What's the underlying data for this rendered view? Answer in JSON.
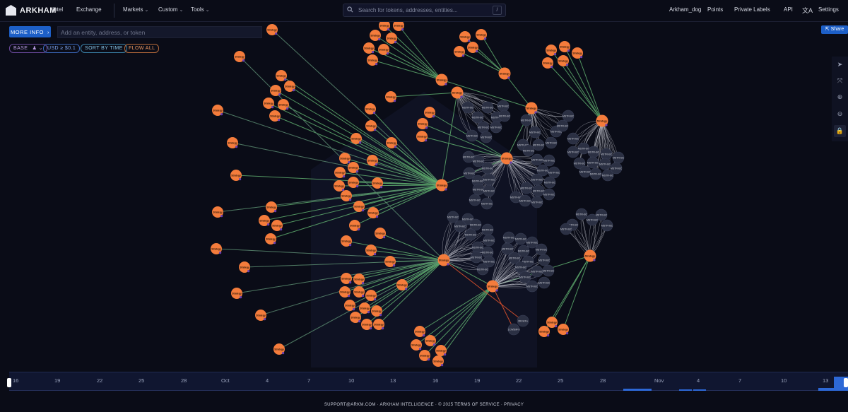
{
  "header": {
    "logo_text": "ARKHAM",
    "nav": [
      {
        "label": "Intel",
        "chevron": false
      },
      {
        "label": "Exchange",
        "chevron": false
      },
      {
        "label": "Markets",
        "chevron": true
      },
      {
        "label": "Custom",
        "chevron": true
      },
      {
        "label": "Tools",
        "chevron": true
      }
    ],
    "search": {
      "placeholder": "Search for tokens, addresses, entities...",
      "shortcut": "/"
    },
    "right_nav": [
      "Arkham_dog",
      "Points",
      "Private Labels",
      "API",
      "Settings"
    ],
    "translate_icon": "translate-icon"
  },
  "toolbar": {
    "more_info_label": "MORE INFO",
    "entity_input_placeholder": "Add an entity, address, or token",
    "filters": {
      "base": "BASE",
      "usd": "USD ≥ $0.1",
      "sort": "SORT BY TIME",
      "flow": "FLOW ALL"
    },
    "share_label": "Share"
  },
  "graph": {
    "entity_node_label": "Strategy",
    "address_node_label": "MSTR-BC",
    "colors": {
      "background": "#0a0c17",
      "entity_node": "#f47c3c",
      "address_node": "#2b3043",
      "inflow_edge": "#5fae6e",
      "outflow_edge": "#c94b2b",
      "internal_edge": "#c9cbd4"
    },
    "special_nodes": [
      "3RmKFu",
      "1CW5MFb"
    ]
  },
  "timeline": {
    "ticks": [
      "16",
      "19",
      "22",
      "25",
      "28",
      "Oct",
      "4",
      "7",
      "10",
      "13",
      "16",
      "19",
      "22",
      "25",
      "28",
      "Nov",
      "4",
      "7",
      "10",
      "13"
    ]
  },
  "footer": {
    "text": "SUPPORT@ARKM.COM · ARKHAM INTELLIGENCE · © 2025   TERMS OF SERVICE · PRIVACY"
  },
  "side_tools": [
    "cursor-icon",
    "fit-icon",
    "zoom-in-icon",
    "zoom-out-icon",
    "lock-icon"
  ]
}
